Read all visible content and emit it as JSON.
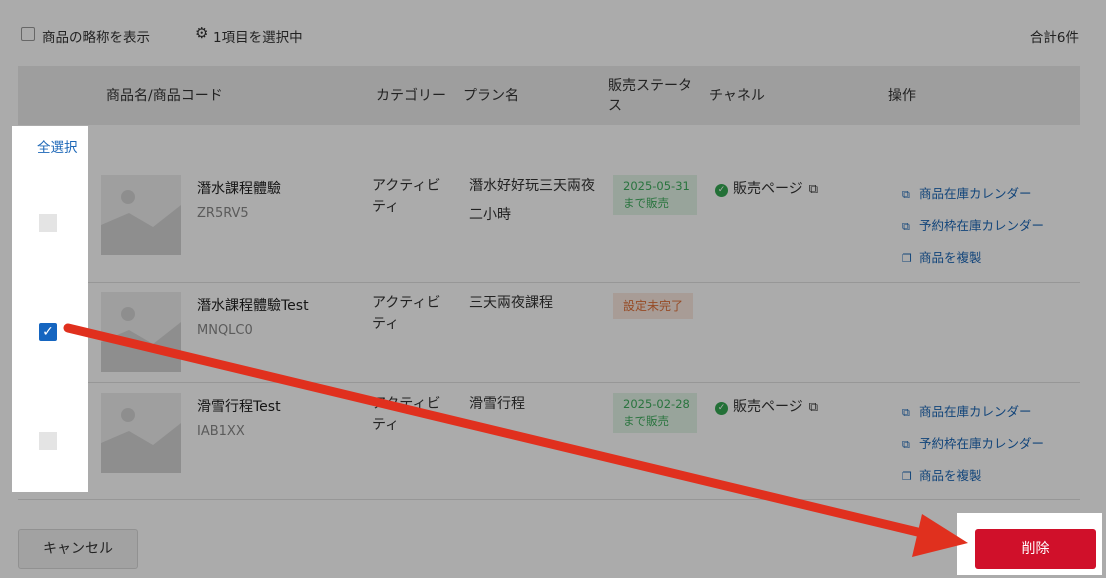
{
  "toolbar": {
    "show_abbrev_label": "商品の略称を表示",
    "selected_count_label": "1項目を選択中",
    "total_label": "合計6件"
  },
  "table": {
    "headers": {
      "name": "商品名/商品コード",
      "category": "カテゴリー",
      "plan": "プラン名",
      "status": [
        "販売ステータ",
        "ス"
      ],
      "channel": "チャネル",
      "actions": "操作"
    },
    "rows": [
      {
        "name": "潛水課程體驗",
        "code": "ZR5RV5",
        "category": [
          "アクティビ",
          "ティ"
        ],
        "plan": [
          "潛水好好玩三天兩夜",
          "二小時"
        ],
        "status": [
          "2025-05-31",
          "まで販売"
        ],
        "channel": "販売ページ",
        "actions": [
          "商品在庫カレンダー",
          "予約枠在庫カレンダー",
          "商品を複製"
        ],
        "checked": false
      },
      {
        "name": "潛水課程體驗Test",
        "code": "MNQLC0",
        "category": [
          "アクティビ",
          "ティ"
        ],
        "plan": [
          "三天兩夜課程"
        ],
        "status": [
          "設定未完了"
        ],
        "checked": true
      },
      {
        "name": "滑雪行程Test",
        "code": "IAB1XX",
        "category": [
          "アクティビ",
          "ティ"
        ],
        "plan": [
          "滑雪行程"
        ],
        "status": [
          "2025-02-28",
          "まで販売"
        ],
        "channel": "販売ページ",
        "actions": [
          "商品在庫カレンダー",
          "予約枠在庫カレンダー",
          "商品を複製"
        ],
        "checked": false
      }
    ]
  },
  "select_all_label": "全選択",
  "footer": {
    "cancel_label": "キャンセル",
    "delete_label": "削除"
  },
  "colors": {
    "accent_blue": "#1c67b7",
    "checkbox_blue": "#1565c0",
    "delete_red": "#d0102a",
    "annotation_arrow": "#e0301e",
    "status_green": "#3fae5e",
    "status_orange": "#e0713a"
  },
  "icons": {
    "settings": "gear-icon",
    "channel_ok": "check-circle-icon",
    "external": "external-link-icon",
    "copy": "copy-icon",
    "thumbnail": "image-placeholder-icon"
  }
}
